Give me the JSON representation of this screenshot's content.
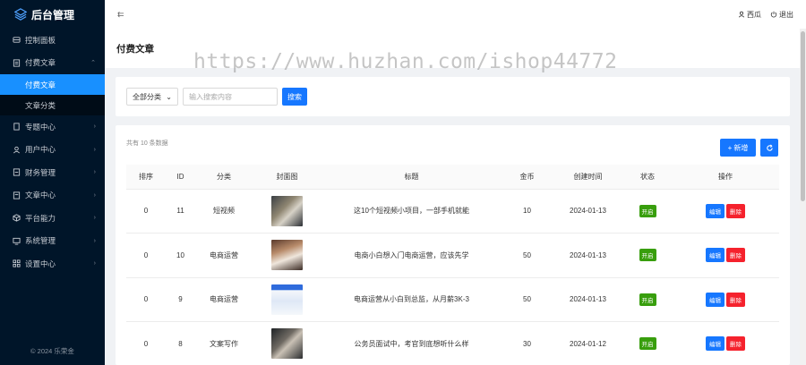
{
  "app": {
    "title": "后台管理"
  },
  "sidebar": {
    "items": [
      {
        "label": "控制面板",
        "icon": "dashboard-icon",
        "arrow": false
      },
      {
        "label": "付费文章",
        "icon": "document-icon",
        "arrow": true,
        "expanded": true,
        "children": [
          {
            "label": "付费文章",
            "active": true
          },
          {
            "label": "文章分类",
            "active": false
          }
        ]
      },
      {
        "label": "专题中心",
        "icon": "bookmark-icon",
        "arrow": true
      },
      {
        "label": "用户中心",
        "icon": "user-icon",
        "arrow": true
      },
      {
        "label": "财务管理",
        "icon": "finance-icon",
        "arrow": true
      },
      {
        "label": "文章中心",
        "icon": "file-icon",
        "arrow": true
      },
      {
        "label": "平台能力",
        "icon": "cube-icon",
        "arrow": true
      },
      {
        "label": "系统管理",
        "icon": "monitor-icon",
        "arrow": true
      },
      {
        "label": "设置中心",
        "icon": "grid-icon",
        "arrow": true
      }
    ],
    "footer": "© 2024 乐荣金"
  },
  "topbar": {
    "user_label": "西瓜",
    "logout_label": "退出"
  },
  "page": {
    "title": "付费文章"
  },
  "watermark": "https://www.huzhan.com/ishop44772",
  "search": {
    "category_value": "全部分类",
    "placeholder": "输入搜索内容",
    "button_label": "搜索"
  },
  "table": {
    "info": "共有 10 条数据",
    "add_label": "新增",
    "columns": [
      "排序",
      "ID",
      "分类",
      "封面图",
      "标题",
      "金币",
      "创建时间",
      "状态",
      "操作"
    ],
    "rows": [
      {
        "sort": "0",
        "id": "11",
        "category": "短视频",
        "title": "这10个短视频小项目，一部手机就能",
        "coins": "10",
        "created": "2024-01-13",
        "status": "开启"
      },
      {
        "sort": "0",
        "id": "10",
        "category": "电商运营",
        "title": "电商小白想入门电商运营，应该先学",
        "coins": "50",
        "created": "2024-01-13",
        "status": "开启"
      },
      {
        "sort": "0",
        "id": "9",
        "category": "电商运营",
        "title": "电商运营从小白到总监，从月薪3K-3",
        "coins": "50",
        "created": "2024-01-13",
        "status": "开启"
      },
      {
        "sort": "0",
        "id": "8",
        "category": "文案写作",
        "title": "公务员面试中，考官到底想听什么样",
        "coins": "30",
        "created": "2024-01-12",
        "status": "开启"
      }
    ],
    "edit_label": "编辑",
    "delete_label": "删除"
  },
  "colors": {
    "sidebar_bg": "#001529",
    "primary": "#1677ff",
    "danger": "#f5222d",
    "success": "#389e0d"
  }
}
